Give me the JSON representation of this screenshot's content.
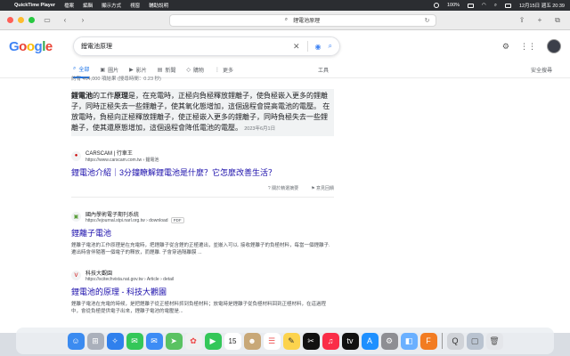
{
  "menubar": {
    "app_name": "QuickTime Player",
    "menus": [
      "檔案",
      "編輯",
      "顯示方式",
      "視窗",
      "輔助說明"
    ],
    "status_percent": "100%",
    "datetime": "12月15日 週五 20:39"
  },
  "browser": {
    "address": "鋰電池原理"
  },
  "google": {
    "logo": {
      "g1": "G",
      "o1": "o",
      "o2": "o",
      "g2": "g",
      "l": "l",
      "e": "e"
    },
    "query": "鋰電池原理",
    "tabs": [
      {
        "label": "全部",
        "icon": "search-icon"
      },
      {
        "label": "圖片",
        "icon": "image-icon"
      },
      {
        "label": "影片",
        "icon": "video-icon"
      },
      {
        "label": "新聞",
        "icon": "news-icon"
      },
      {
        "label": "購物",
        "icon": "shopping-icon"
      },
      {
        "label": "更多",
        "icon": "more-icon"
      }
    ],
    "tools_label": "工具",
    "safesearch_label": "安全搜尋",
    "stats": "約有 464,000 項結果 (搜尋時間：0.23 秒)"
  },
  "featured": {
    "bold_start": "鋰電池",
    "text1": "的工作",
    "bold_mid": "原理",
    "text2": "是，在充電時，正極向負極釋放鋰離子，使負極嵌入更多的鋰離子，同時正極失去一些鋰離子，使其氧化態增加，這個過程會提高電池的電壓。 在放電時，負極向正極釋放鋰離子，使正極嵌入更多的鋰離子，同時負極失去一些鋰離子，使其還原態增加，這個過程會降低電池的電壓。",
    "date": "2023年6月1日",
    "source_name": "CARSCAM | 行車王",
    "source_url": "https://www.carscam.com.tw › 鋰電池",
    "title": "鋰電池介紹｜3分鐘瞭解鋰電池是什麼？它怎麼改善生活？",
    "feedback_about": "關於精選摘要",
    "feedback": "意見回饋"
  },
  "results": [
    {
      "source_name": "國內學術電子期刊系統",
      "source_url": "https://ejournal.stpi.narl.org.tw › download",
      "badge": "PDF",
      "title": "鋰離子電池",
      "desc": "鋰離子電池的工作原理是在充電時，把鋰離子從含鋰的正極遷出，並嵌入可以. 接收鋰離子的負極材料，每當一個鋰離子. 遷出時會伴隨著一個電子的釋放，而鋰離. 子會穿過隔離膜 ..."
    },
    {
      "source_name": "科技大觀園",
      "source_url": "https://scitechvista.nat.gov.tw › Article › detail",
      "title": "鋰電池的原理 - 科技大觀園",
      "desc": "鋰離子電池在充電的時候，是把鋰離子從正極材料抓到負極材料；放電時是鋰離子從負極材料回到正極材料，在這過程中，會從負極提供電子出來，鋰離子電池的電壓是..."
    }
  ],
  "dock": {
    "apps": [
      "finder",
      "launchpad",
      "safari",
      "messages",
      "mail",
      "maps",
      "photos",
      "facetime",
      "calendar",
      "contacts",
      "reminders",
      "notes",
      "capcut",
      "music",
      "tv",
      "appstore",
      "settings",
      "preview",
      "finalcut",
      "quicktime",
      "trash"
    ],
    "calendar_day": "15"
  }
}
